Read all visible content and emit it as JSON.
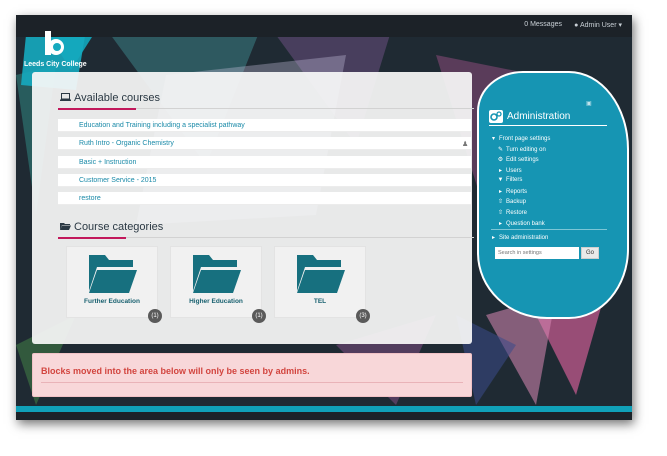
{
  "topbar": {
    "messages": "0 Messages",
    "user": "Admin User"
  },
  "logo": {
    "text": "Leeds City College"
  },
  "available_courses": {
    "title": "Available courses",
    "courses": [
      "Education and Training including a specialist pathway",
      "Ruth Intro - Organic Chemistry",
      "Basic + Instruction",
      "Customer Service - 2015",
      "restore"
    ]
  },
  "course_categories": {
    "title": "Course categories",
    "items": [
      {
        "name": "Further Education",
        "count": "(1)"
      },
      {
        "name": "Higher Education",
        "count": "(1)"
      },
      {
        "name": "TEL",
        "count": "(3)"
      }
    ]
  },
  "administration": {
    "title": "Administration",
    "front_page_settings": "Front page settings",
    "items": [
      "Turn editing on",
      "Edit settings",
      "Users",
      "Filters",
      "Reports",
      "Backup",
      "Restore",
      "Question bank"
    ],
    "site_administration": "Site administration",
    "search_placeholder": "Search in settings",
    "go_label": "Go"
  },
  "notice": {
    "text": "Blocks moved into the area below will only be seen by admins."
  },
  "colors": {
    "accent": "#1695b3",
    "brand": "#c2185b",
    "folder": "#17707f",
    "notice_text": "#d2453f"
  }
}
